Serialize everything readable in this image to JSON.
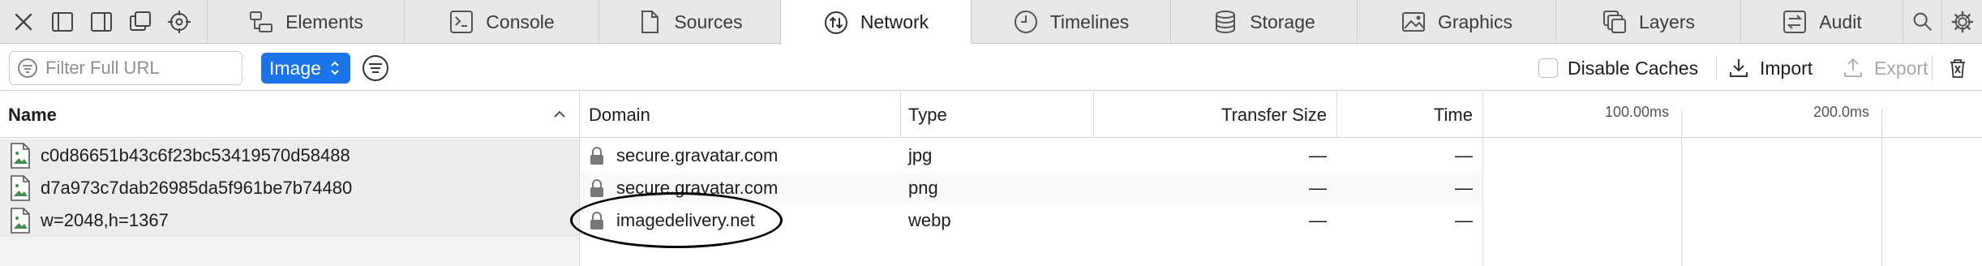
{
  "tabbar": {
    "tools": [
      {
        "name": "close-icon"
      },
      {
        "name": "dock-bottom-icon"
      },
      {
        "name": "dock-right-icon"
      },
      {
        "name": "detach-window-icon"
      },
      {
        "name": "element-picker-icon"
      }
    ],
    "tabs": [
      {
        "label": "Elements",
        "icon": "elements-icon"
      },
      {
        "label": "Console",
        "icon": "console-icon"
      },
      {
        "label": "Sources",
        "icon": "sources-icon"
      },
      {
        "label": "Network",
        "icon": "network-icon",
        "selected": true
      },
      {
        "label": "Timelines",
        "icon": "timelines-icon"
      },
      {
        "label": "Storage",
        "icon": "storage-icon"
      },
      {
        "label": "Graphics",
        "icon": "graphics-icon"
      },
      {
        "label": "Layers",
        "icon": "layers-icon"
      },
      {
        "label": "Audit",
        "icon": "audit-icon"
      }
    ],
    "search_icon": "search-icon",
    "settings_icon": "gear-icon"
  },
  "filterbar": {
    "filter_placeholder": "Filter Full URL",
    "filter_value": "",
    "resource_type": "Image",
    "disable_caches_label": "Disable Caches",
    "disable_caches_checked": false,
    "import_label": "Import",
    "export_label": "Export",
    "accent_color": "#1a73e8"
  },
  "grid": {
    "columns": {
      "name": "Name",
      "domain": "Domain",
      "type": "Type",
      "transfer_size": "Transfer Size",
      "time": "Time"
    },
    "timeline_ticks": [
      "100.00ms",
      "200.0ms"
    ],
    "rows": [
      {
        "name": "c0d86651b43c6f23bc53419570d58488",
        "domain": "secure.gravatar.com",
        "type": "jpg",
        "transfer_size": "—",
        "time": "—"
      },
      {
        "name": "d7a973c7dab26985da5f961be7b74480",
        "domain": "secure.gravatar.com",
        "type": "png",
        "transfer_size": "—",
        "time": "—"
      },
      {
        "name": "w=2048,h=1367",
        "domain": "imagedelivery.net",
        "type": "webp",
        "transfer_size": "—",
        "time": "—"
      }
    ]
  }
}
